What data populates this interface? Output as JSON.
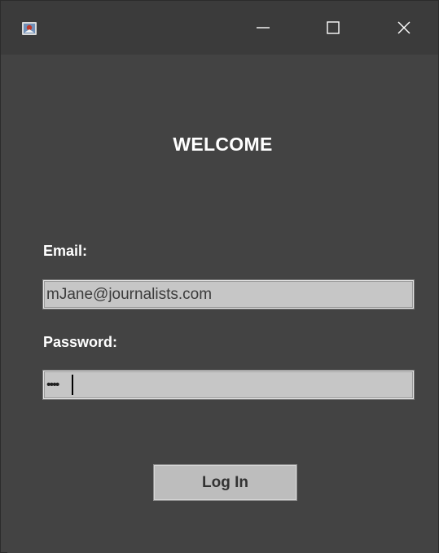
{
  "window": {
    "controls": {
      "minimize": "minimize-icon",
      "maximize": "maximize-icon",
      "close": "close-icon"
    }
  },
  "form": {
    "heading": "WELCOME",
    "email_label": "Email:",
    "email_value": "mJane@journalists.com",
    "password_label": "Password:",
    "password_masked": "••••",
    "submit_label": "Log In"
  },
  "colors": {
    "background": "#434343",
    "titlebar": "#3b3b3b",
    "field": "#c6c6c6",
    "button": "#bdbdbd",
    "text": "#ffffff"
  }
}
